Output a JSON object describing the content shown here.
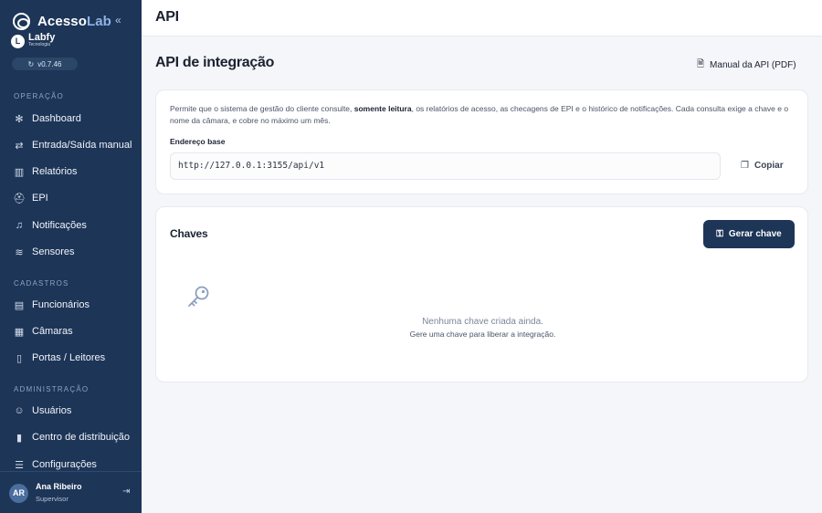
{
  "app": {
    "brand_main": "Acesso",
    "brand_accent": "Lab",
    "partner_name": "Labfy",
    "partner_sub": "Tecnologia",
    "version": "v0.7.46"
  },
  "sidebar": {
    "sections": [
      {
        "label": "OPERAÇÃO",
        "items": [
          {
            "label": "Dashboard",
            "icon": "dashboard-icon"
          },
          {
            "label": "Entrada/Saída manual",
            "icon": "swap-arrows-icon"
          },
          {
            "label": "Relatórios",
            "icon": "bar-chart-icon"
          },
          {
            "label": "EPI",
            "icon": "helmet-icon"
          },
          {
            "label": "Notificações",
            "icon": "bell-icon"
          },
          {
            "label": "Sensores",
            "icon": "wifi-icon"
          }
        ]
      },
      {
        "label": "CADASTROS",
        "items": [
          {
            "label": "Funcionários",
            "icon": "id-card-icon"
          },
          {
            "label": "Câmaras",
            "icon": "camera-icon"
          },
          {
            "label": "Portas / Leitores",
            "icon": "door-icon"
          }
        ]
      },
      {
        "label": "ADMINISTRAÇÃO",
        "items": [
          {
            "label": "Usuários",
            "icon": "users-icon"
          },
          {
            "label": "Centro de distribuição",
            "icon": "building-icon"
          },
          {
            "label": "Configurações",
            "icon": "sliders-icon"
          }
        ]
      }
    ],
    "user": {
      "initials": "AR",
      "name": "Ana Ribeiro",
      "role": "Supervisor"
    }
  },
  "topbar": {
    "title": "API"
  },
  "main": {
    "page_title": "API de integração",
    "manual_label": "Manual da API (PDF)",
    "description_pre": "Permite que o sistema de gestão do cliente consulte, ",
    "description_bold": "somente leitura",
    "description_post": ", os relatórios de acesso, as checagens de EPI e o histórico de notificações. Cada consulta exige a chave e o nome da câmara, e cobre no máximo um mês.",
    "base_label": "Endereço base",
    "base_url": "http://127.0.0.1:3155/api/v1",
    "copy_label": "Copiar",
    "keys_title": "Chaves",
    "generate_label": "Gerar chave",
    "empty_title": "Nenhuma chave criada ainda.",
    "empty_sub": "Gere uma chave para liberar a integração."
  },
  "colors": {
    "sidebar_bg": "#1d3557",
    "accent": "#8fb3e6",
    "page_bg": "#f4f6f9"
  }
}
